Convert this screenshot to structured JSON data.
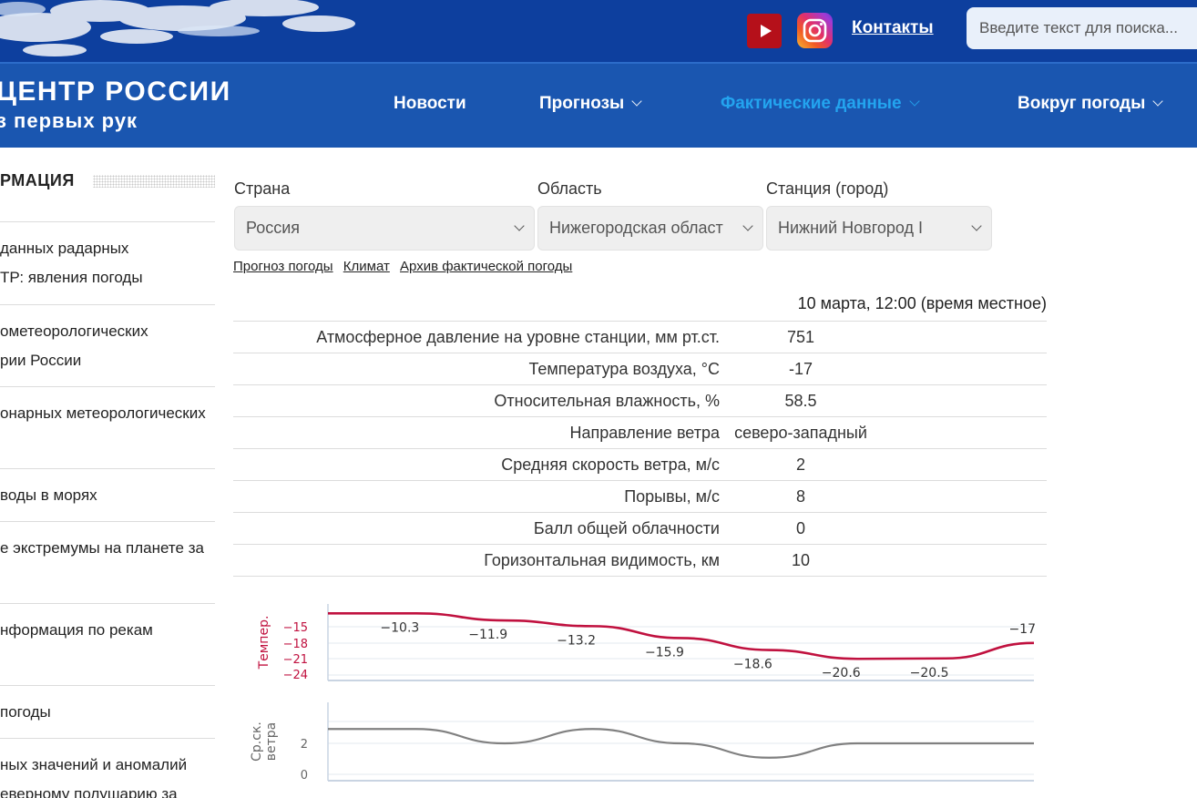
{
  "header": {
    "icons": {
      "youtube": "youtube-icon",
      "instagram": "instagram-icon"
    },
    "contacts_label": "Контакты",
    "search_placeholder": "Введите текст для поиска..."
  },
  "logo": {
    "title": "ЦЕНТР РОССИИ",
    "subtitle": "з первых рук"
  },
  "nav": {
    "items": [
      {
        "label": "Новости",
        "has_dropdown": false
      },
      {
        "label": "Прогнозы",
        "has_dropdown": true
      },
      {
        "label": "Фактические данные",
        "has_dropdown": true,
        "active": true
      },
      {
        "label": "Вокруг погоды",
        "has_dropdown": true
      }
    ]
  },
  "sidebar": {
    "heading": "РМАЦИЯ",
    "items": [
      {
        "lines": [
          "данных радарных",
          "ТР: явления погоды"
        ]
      },
      {
        "lines": [
          "ометеорологических",
          "рии России"
        ]
      },
      {
        "lines": [
          "онарных метеорологических"
        ]
      },
      {
        "lines": [
          "воды в морях"
        ]
      },
      {
        "lines": [
          "е экстремумы на планете за"
        ]
      },
      {
        "lines": [
          "нформация по рекам"
        ]
      },
      {
        "lines": [
          "погоды"
        ]
      },
      {
        "lines": [
          "ных значений и аномалий",
          "еверному полушарию за"
        ]
      }
    ]
  },
  "filters": {
    "country": {
      "label": "Страна",
      "value": "Россия"
    },
    "region": {
      "label": "Область",
      "value": "Нижегородская област"
    },
    "station": {
      "label": "Станция (город)",
      "value": "Нижний Новгород I"
    }
  },
  "links": [
    "Прогноз погоды",
    "Климат",
    "Архив фактической погоды"
  ],
  "observation": {
    "datetime": "10 марта, 12:00 (время местное)",
    "rows": [
      {
        "param": "Атмосферное давление на уровне станции, мм рт.ст.",
        "value": "751"
      },
      {
        "param": "Температура воздуха, °C",
        "value": "-17"
      },
      {
        "param": "Относительная влажность, %",
        "value": "58.5"
      },
      {
        "param": "Направление ветра",
        "value": "северо-западный"
      },
      {
        "param": "Средняя скорость ветра, м/с",
        "value": "2"
      },
      {
        "param": "Порывы, м/с",
        "value": "8"
      },
      {
        "param": "Балл общей облачности",
        "value": "0"
      },
      {
        "param": "Горизонтальная видимость, км",
        "value": "10"
      }
    ]
  },
  "chart_data": [
    {
      "type": "line",
      "ylabel": "Темпер.",
      "yticks": [
        "−15",
        "−18",
        "−21",
        "−24"
      ],
      "ylim": [
        -25.5,
        -9
      ],
      "values": [
        -10.3,
        -10.3,
        -11.9,
        -13.2,
        -15.9,
        -18.6,
        -20.6,
        -20.5,
        -17
      ],
      "labels": [
        "",
        "−10.3",
        "−11.9",
        "−13.2",
        "−15.9",
        "−18.6",
        "−20.6",
        "−20.5",
        "−17"
      ],
      "color": "#c0113f"
    },
    {
      "type": "line",
      "ylabel": "Ср.ск. ветра",
      "yticks": [
        "2",
        "0"
      ],
      "ylim": [
        -0.6,
        4.6
      ],
      "values": [
        3,
        3,
        2,
        3,
        2,
        1,
        2,
        2,
        2
      ],
      "color": "#808080"
    }
  ]
}
